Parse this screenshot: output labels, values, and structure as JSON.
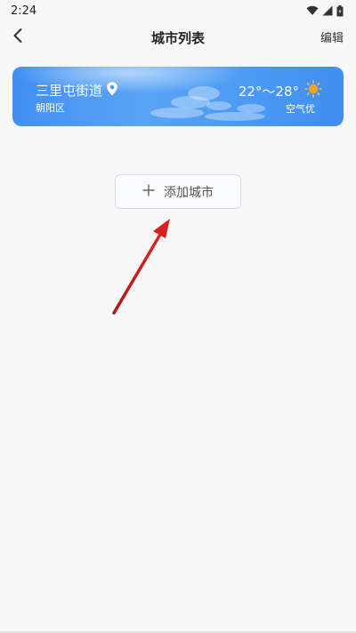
{
  "status_bar": {
    "time": "2:24",
    "icons": [
      "wifi-icon",
      "signal-icon",
      "battery-icon"
    ]
  },
  "app_bar": {
    "title": "城市列表",
    "edit_label": "编辑",
    "back_icon": "chevron-left-icon"
  },
  "city_card": {
    "name": "三里屯街道",
    "district": "朝阳区",
    "temperature": "22°～28°",
    "air_quality": "空气优",
    "location_icon": "location-pin-icon",
    "weather_icon": "sun-icon",
    "colors": {
      "gradient_start": "#3f8ef2",
      "gradient_mid": "#5aa4f6",
      "sun": "#f6a623"
    }
  },
  "add_city": {
    "label": "添加城市",
    "icon": "plus-icon"
  },
  "colors": {
    "background": "#f7f7f7",
    "annotation_arrow": "#d61f1f"
  }
}
